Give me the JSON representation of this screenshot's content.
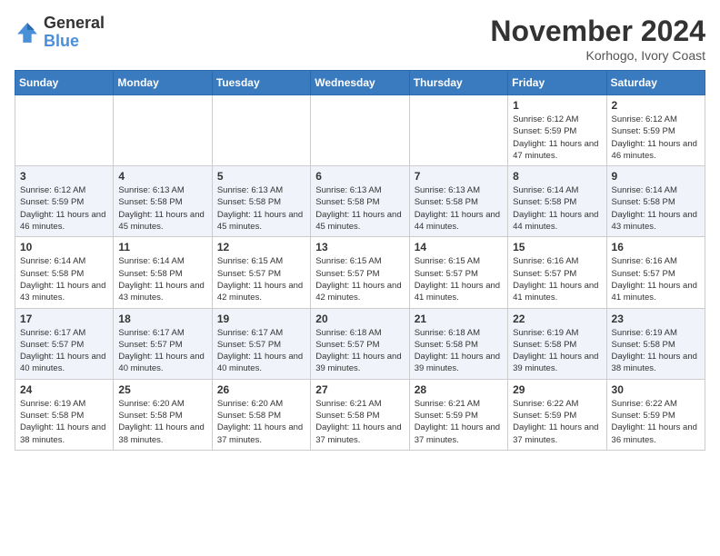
{
  "logo": {
    "line1": "General",
    "line2": "Blue"
  },
  "header": {
    "month_year": "November 2024",
    "location": "Korhogo, Ivory Coast"
  },
  "days_of_week": [
    "Sunday",
    "Monday",
    "Tuesday",
    "Wednesday",
    "Thursday",
    "Friday",
    "Saturday"
  ],
  "weeks": [
    [
      {
        "num": "",
        "info": ""
      },
      {
        "num": "",
        "info": ""
      },
      {
        "num": "",
        "info": ""
      },
      {
        "num": "",
        "info": ""
      },
      {
        "num": "",
        "info": ""
      },
      {
        "num": "1",
        "info": "Sunrise: 6:12 AM\nSunset: 5:59 PM\nDaylight: 11 hours and 47 minutes."
      },
      {
        "num": "2",
        "info": "Sunrise: 6:12 AM\nSunset: 5:59 PM\nDaylight: 11 hours and 46 minutes."
      }
    ],
    [
      {
        "num": "3",
        "info": "Sunrise: 6:12 AM\nSunset: 5:59 PM\nDaylight: 11 hours and 46 minutes."
      },
      {
        "num": "4",
        "info": "Sunrise: 6:13 AM\nSunset: 5:58 PM\nDaylight: 11 hours and 45 minutes."
      },
      {
        "num": "5",
        "info": "Sunrise: 6:13 AM\nSunset: 5:58 PM\nDaylight: 11 hours and 45 minutes."
      },
      {
        "num": "6",
        "info": "Sunrise: 6:13 AM\nSunset: 5:58 PM\nDaylight: 11 hours and 45 minutes."
      },
      {
        "num": "7",
        "info": "Sunrise: 6:13 AM\nSunset: 5:58 PM\nDaylight: 11 hours and 44 minutes."
      },
      {
        "num": "8",
        "info": "Sunrise: 6:14 AM\nSunset: 5:58 PM\nDaylight: 11 hours and 44 minutes."
      },
      {
        "num": "9",
        "info": "Sunrise: 6:14 AM\nSunset: 5:58 PM\nDaylight: 11 hours and 43 minutes."
      }
    ],
    [
      {
        "num": "10",
        "info": "Sunrise: 6:14 AM\nSunset: 5:58 PM\nDaylight: 11 hours and 43 minutes."
      },
      {
        "num": "11",
        "info": "Sunrise: 6:14 AM\nSunset: 5:58 PM\nDaylight: 11 hours and 43 minutes."
      },
      {
        "num": "12",
        "info": "Sunrise: 6:15 AM\nSunset: 5:57 PM\nDaylight: 11 hours and 42 minutes."
      },
      {
        "num": "13",
        "info": "Sunrise: 6:15 AM\nSunset: 5:57 PM\nDaylight: 11 hours and 42 minutes."
      },
      {
        "num": "14",
        "info": "Sunrise: 6:15 AM\nSunset: 5:57 PM\nDaylight: 11 hours and 41 minutes."
      },
      {
        "num": "15",
        "info": "Sunrise: 6:16 AM\nSunset: 5:57 PM\nDaylight: 11 hours and 41 minutes."
      },
      {
        "num": "16",
        "info": "Sunrise: 6:16 AM\nSunset: 5:57 PM\nDaylight: 11 hours and 41 minutes."
      }
    ],
    [
      {
        "num": "17",
        "info": "Sunrise: 6:17 AM\nSunset: 5:57 PM\nDaylight: 11 hours and 40 minutes."
      },
      {
        "num": "18",
        "info": "Sunrise: 6:17 AM\nSunset: 5:57 PM\nDaylight: 11 hours and 40 minutes."
      },
      {
        "num": "19",
        "info": "Sunrise: 6:17 AM\nSunset: 5:57 PM\nDaylight: 11 hours and 40 minutes."
      },
      {
        "num": "20",
        "info": "Sunrise: 6:18 AM\nSunset: 5:57 PM\nDaylight: 11 hours and 39 minutes."
      },
      {
        "num": "21",
        "info": "Sunrise: 6:18 AM\nSunset: 5:58 PM\nDaylight: 11 hours and 39 minutes."
      },
      {
        "num": "22",
        "info": "Sunrise: 6:19 AM\nSunset: 5:58 PM\nDaylight: 11 hours and 39 minutes."
      },
      {
        "num": "23",
        "info": "Sunrise: 6:19 AM\nSunset: 5:58 PM\nDaylight: 11 hours and 38 minutes."
      }
    ],
    [
      {
        "num": "24",
        "info": "Sunrise: 6:19 AM\nSunset: 5:58 PM\nDaylight: 11 hours and 38 minutes."
      },
      {
        "num": "25",
        "info": "Sunrise: 6:20 AM\nSunset: 5:58 PM\nDaylight: 11 hours and 38 minutes."
      },
      {
        "num": "26",
        "info": "Sunrise: 6:20 AM\nSunset: 5:58 PM\nDaylight: 11 hours and 37 minutes."
      },
      {
        "num": "27",
        "info": "Sunrise: 6:21 AM\nSunset: 5:58 PM\nDaylight: 11 hours and 37 minutes."
      },
      {
        "num": "28",
        "info": "Sunrise: 6:21 AM\nSunset: 5:59 PM\nDaylight: 11 hours and 37 minutes."
      },
      {
        "num": "29",
        "info": "Sunrise: 6:22 AM\nSunset: 5:59 PM\nDaylight: 11 hours and 37 minutes."
      },
      {
        "num": "30",
        "info": "Sunrise: 6:22 AM\nSunset: 5:59 PM\nDaylight: 11 hours and 36 minutes."
      }
    ]
  ]
}
